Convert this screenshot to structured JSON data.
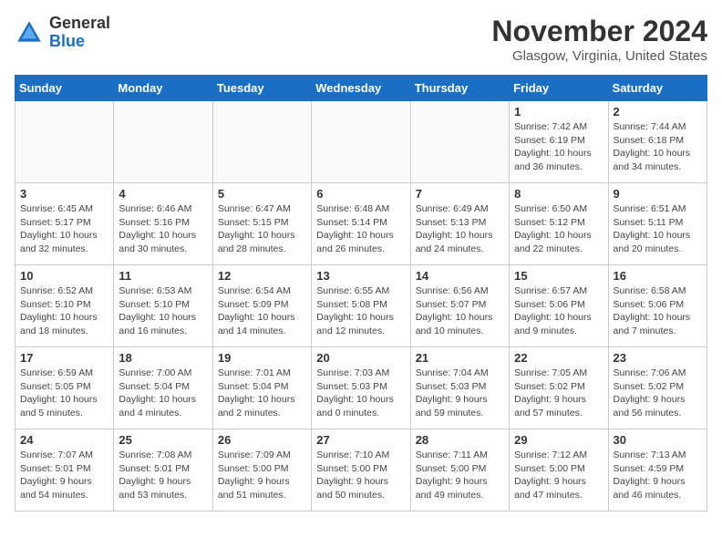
{
  "logo": {
    "general": "General",
    "blue": "Blue"
  },
  "header": {
    "month": "November 2024",
    "location": "Glasgow, Virginia, United States"
  },
  "days_of_week": [
    "Sunday",
    "Monday",
    "Tuesday",
    "Wednesday",
    "Thursday",
    "Friday",
    "Saturday"
  ],
  "weeks": [
    [
      {
        "day": "",
        "detail": ""
      },
      {
        "day": "",
        "detail": ""
      },
      {
        "day": "",
        "detail": ""
      },
      {
        "day": "",
        "detail": ""
      },
      {
        "day": "",
        "detail": ""
      },
      {
        "day": "1",
        "detail": "Sunrise: 7:42 AM\nSunset: 6:19 PM\nDaylight: 10 hours and 36 minutes."
      },
      {
        "day": "2",
        "detail": "Sunrise: 7:44 AM\nSunset: 6:18 PM\nDaylight: 10 hours and 34 minutes."
      }
    ],
    [
      {
        "day": "3",
        "detail": "Sunrise: 6:45 AM\nSunset: 5:17 PM\nDaylight: 10 hours and 32 minutes."
      },
      {
        "day": "4",
        "detail": "Sunrise: 6:46 AM\nSunset: 5:16 PM\nDaylight: 10 hours and 30 minutes."
      },
      {
        "day": "5",
        "detail": "Sunrise: 6:47 AM\nSunset: 5:15 PM\nDaylight: 10 hours and 28 minutes."
      },
      {
        "day": "6",
        "detail": "Sunrise: 6:48 AM\nSunset: 5:14 PM\nDaylight: 10 hours and 26 minutes."
      },
      {
        "day": "7",
        "detail": "Sunrise: 6:49 AM\nSunset: 5:13 PM\nDaylight: 10 hours and 24 minutes."
      },
      {
        "day": "8",
        "detail": "Sunrise: 6:50 AM\nSunset: 5:12 PM\nDaylight: 10 hours and 22 minutes."
      },
      {
        "day": "9",
        "detail": "Sunrise: 6:51 AM\nSunset: 5:11 PM\nDaylight: 10 hours and 20 minutes."
      }
    ],
    [
      {
        "day": "10",
        "detail": "Sunrise: 6:52 AM\nSunset: 5:10 PM\nDaylight: 10 hours and 18 minutes."
      },
      {
        "day": "11",
        "detail": "Sunrise: 6:53 AM\nSunset: 5:10 PM\nDaylight: 10 hours and 16 minutes."
      },
      {
        "day": "12",
        "detail": "Sunrise: 6:54 AM\nSunset: 5:09 PM\nDaylight: 10 hours and 14 minutes."
      },
      {
        "day": "13",
        "detail": "Sunrise: 6:55 AM\nSunset: 5:08 PM\nDaylight: 10 hours and 12 minutes."
      },
      {
        "day": "14",
        "detail": "Sunrise: 6:56 AM\nSunset: 5:07 PM\nDaylight: 10 hours and 10 minutes."
      },
      {
        "day": "15",
        "detail": "Sunrise: 6:57 AM\nSunset: 5:06 PM\nDaylight: 10 hours and 9 minutes."
      },
      {
        "day": "16",
        "detail": "Sunrise: 6:58 AM\nSunset: 5:06 PM\nDaylight: 10 hours and 7 minutes."
      }
    ],
    [
      {
        "day": "17",
        "detail": "Sunrise: 6:59 AM\nSunset: 5:05 PM\nDaylight: 10 hours and 5 minutes."
      },
      {
        "day": "18",
        "detail": "Sunrise: 7:00 AM\nSunset: 5:04 PM\nDaylight: 10 hours and 4 minutes."
      },
      {
        "day": "19",
        "detail": "Sunrise: 7:01 AM\nSunset: 5:04 PM\nDaylight: 10 hours and 2 minutes."
      },
      {
        "day": "20",
        "detail": "Sunrise: 7:03 AM\nSunset: 5:03 PM\nDaylight: 10 hours and 0 minutes."
      },
      {
        "day": "21",
        "detail": "Sunrise: 7:04 AM\nSunset: 5:03 PM\nDaylight: 9 hours and 59 minutes."
      },
      {
        "day": "22",
        "detail": "Sunrise: 7:05 AM\nSunset: 5:02 PM\nDaylight: 9 hours and 57 minutes."
      },
      {
        "day": "23",
        "detail": "Sunrise: 7:06 AM\nSunset: 5:02 PM\nDaylight: 9 hours and 56 minutes."
      }
    ],
    [
      {
        "day": "24",
        "detail": "Sunrise: 7:07 AM\nSunset: 5:01 PM\nDaylight: 9 hours and 54 minutes."
      },
      {
        "day": "25",
        "detail": "Sunrise: 7:08 AM\nSunset: 5:01 PM\nDaylight: 9 hours and 53 minutes."
      },
      {
        "day": "26",
        "detail": "Sunrise: 7:09 AM\nSunset: 5:00 PM\nDaylight: 9 hours and 51 minutes."
      },
      {
        "day": "27",
        "detail": "Sunrise: 7:10 AM\nSunset: 5:00 PM\nDaylight: 9 hours and 50 minutes."
      },
      {
        "day": "28",
        "detail": "Sunrise: 7:11 AM\nSunset: 5:00 PM\nDaylight: 9 hours and 49 minutes."
      },
      {
        "day": "29",
        "detail": "Sunrise: 7:12 AM\nSunset: 5:00 PM\nDaylight: 9 hours and 47 minutes."
      },
      {
        "day": "30",
        "detail": "Sunrise: 7:13 AM\nSunset: 4:59 PM\nDaylight: 9 hours and 46 minutes."
      }
    ]
  ]
}
